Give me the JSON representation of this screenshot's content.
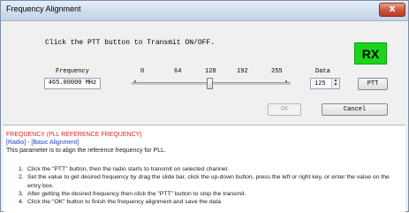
{
  "window": {
    "title": "Frequency Alignment",
    "close_label": "x"
  },
  "instruction": "Click the PTT button to Transmit ON/OFF.",
  "status_indicator": {
    "label": "RX",
    "color": "#1bd41b"
  },
  "frequency": {
    "label": "Frequency",
    "value": "465.00000 MHz"
  },
  "slider": {
    "ticks": [
      "0",
      "64",
      "128",
      "192",
      "255"
    ],
    "value": 125,
    "min": 0,
    "max": 255
  },
  "data": {
    "label": "Data",
    "value": "125"
  },
  "buttons": {
    "ptt": "PTT",
    "ok": "OK",
    "cancel": "Cancel"
  },
  "help": {
    "title": "FREQUENCY (PLL REFERENCE FREQUENCY)",
    "path": "[Radio] - [Basic Alignment]",
    "description": "This parameter is to align the reference frequency for PLL.",
    "steps": [
      {
        "num": "1.",
        "text": "Click the \"PTT\" button, then the radio starts to transmit on selected channel."
      },
      {
        "num": "2.",
        "text": "Set the value to get desired frequency by drag the slide bar, click the up-down button, press the left or right key, or enter the value on the entry box."
      },
      {
        "num": "3.",
        "text": "After getting the desired frequency then click the \"PTT\" button to stop the transmit."
      },
      {
        "num": "4.",
        "text": "Click the \"OK\" button to finish the frequency alignment and save the data"
      }
    ]
  }
}
